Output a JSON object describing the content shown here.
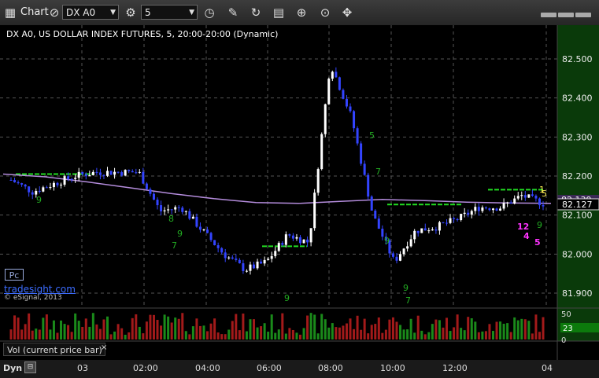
{
  "toolbar": {
    "chart_label": "Chart",
    "symbol": "DX A0",
    "interval": "5"
  },
  "chart": {
    "header": "DX A0, US DOLLAR INDEX FUTURES, 5, 20:00-20:00 (Dynamic)",
    "pc_label": "Pc",
    "watermark": "tradesight.com",
    "copyright": "© eSignal, 2013",
    "current_price": "82.127",
    "partial_price_tag": "82.139",
    "colors": {
      "up": "#ffffff",
      "down": "#3344ff",
      "sma": "#b48cdc",
      "level": "#22dd22",
      "axis_bg": "#0a3a0a"
    }
  },
  "chart_data": {
    "type": "line",
    "y_ticks": [
      "82.500",
      "82.400",
      "82.300",
      "82.200",
      "82.100",
      "82.000",
      "81.900"
    ],
    "ylim": [
      81.87,
      82.57
    ],
    "x_ticks": [
      "03",
      "02:00",
      "04:00",
      "06:00",
      "08:00",
      "10:00",
      "12:00",
      "04"
    ],
    "series": [
      {
        "name": "",
        "x": [
          "20:00",
          "21:00",
          "22:00",
          "23:00",
          "00:00",
          "01:00",
          "02:00",
          "02:30",
          "03:00",
          "04:00",
          "05:00",
          "06:00",
          "07:00",
          "07:30",
          "08:00",
          "08:30",
          "09:00",
          "09:30",
          "10:00",
          "10:30",
          "11:00",
          "11:30",
          "12:00",
          "13:00",
          "14:00",
          "15:00"
        ],
        "values": [
          82.19,
          82.16,
          82.18,
          82.2,
          82.21,
          82.21,
          82.21,
          82.11,
          82.12,
          82.06,
          82.0,
          81.96,
          81.98,
          82.05,
          82.03,
          82.49,
          82.35,
          82.1,
          81.98,
          82.06,
          82.07,
          82.09,
          82.12,
          82.12,
          82.15,
          82.13
        ]
      }
    ],
    "level_lines": [
      82.205,
      82.02,
      82.127,
      82.165
    ],
    "annotations": [
      "9",
      "8",
      "7",
      "9",
      "5",
      "9",
      "7",
      "9",
      "9",
      "7",
      "9",
      "5",
      "1",
      "12",
      "4",
      "5"
    ]
  },
  "volume": {
    "label": "Vol (current price bar)",
    "close_label": "×",
    "scale_top": "50",
    "scale_bottom": "0",
    "current": "23"
  },
  "bottom": {
    "dyn_label": "Dyn"
  }
}
